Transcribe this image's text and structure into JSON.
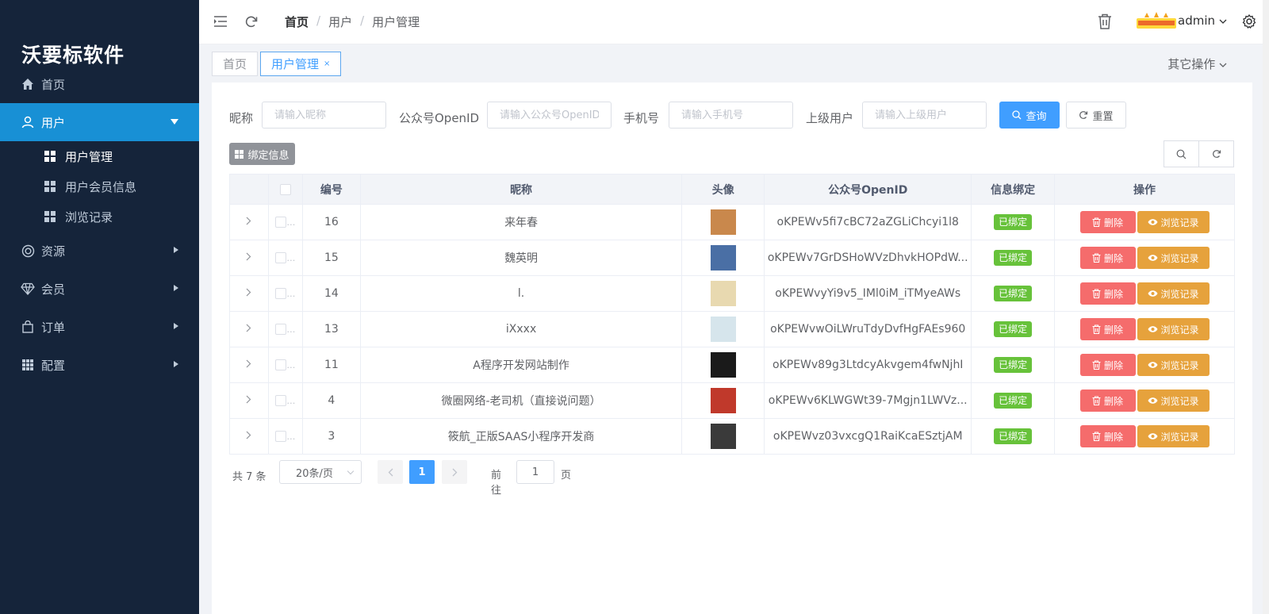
{
  "app": {
    "brand": "沃要标软件",
    "user": "admin"
  },
  "sidebar": {
    "items": [
      {
        "label": "首页",
        "icon": "home-icon"
      },
      {
        "label": "用户",
        "icon": "user-icon",
        "active": true
      },
      {
        "label": "资源",
        "icon": "resource-icon"
      },
      {
        "label": "会员",
        "icon": "diamond-icon"
      },
      {
        "label": "订单",
        "icon": "bag-icon"
      },
      {
        "label": "配置",
        "icon": "grid-icon"
      }
    ],
    "sub_items": [
      {
        "label": "用户管理",
        "active": true
      },
      {
        "label": "用户会员信息"
      },
      {
        "label": "浏览记录"
      }
    ]
  },
  "header": {
    "breadcrumb": [
      "首页",
      "用户",
      "用户管理"
    ],
    "sep": "/"
  },
  "tabs": {
    "items": [
      {
        "label": "首页"
      },
      {
        "label": "用户管理",
        "close": "×"
      }
    ],
    "other_ops": "其它操作"
  },
  "filters": {
    "nickname": {
      "label": "昵称",
      "placeholder": "请输入昵称"
    },
    "openid": {
      "label": "公众号OpenID",
      "placeholder": "请输入公众号OpenID"
    },
    "phone": {
      "label": "手机号",
      "placeholder": "请输入手机号"
    },
    "parent": {
      "label": "上级用户",
      "placeholder": "请输入上级用户"
    },
    "search_btn": "查询",
    "reset_btn": "重置",
    "bind_btn": "绑定信息"
  },
  "table": {
    "headers": [
      "编号",
      "昵称",
      "头像",
      "公众号OpenID",
      "信息绑定",
      "操作"
    ],
    "rows": [
      {
        "id": "16",
        "nickname": "来年春",
        "openid": "oKPEWv5fi7cBC72aZGLiChcyi1l8",
        "bind": "已绑定",
        "avatar_color": "#c9884c"
      },
      {
        "id": "15",
        "nickname": "魏英明",
        "openid": "oKPEWv7GrDSHoWVzDhvkHOPdW...",
        "bind": "已绑定",
        "avatar_color": "#4a6fa5"
      },
      {
        "id": "14",
        "nickname": "l.",
        "openid": "oKPEWvyYi9v5_IMl0iM_iTMyeAWs",
        "bind": "已绑定",
        "avatar_color": "#e8d9b0"
      },
      {
        "id": "13",
        "nickname": "iXxxx",
        "openid": "oKPEWvwOiLWruTdyDvfHgFAEs960",
        "bind": "已绑定",
        "avatar_color": "#d6e5ec"
      },
      {
        "id": "11",
        "nickname": "A程序开发网站制作",
        "openid": "oKPEWv89g3LtdcyAkvgem4fwNjhI",
        "bind": "已绑定",
        "avatar_color": "#1a1a1a"
      },
      {
        "id": "4",
        "nickname": "微圈网络-老司机（直接说问题）",
        "openid": "oKPEWv6KLWGWt39-7Mgjn1LWVz...",
        "bind": "已绑定",
        "avatar_color": "#c0392b"
      },
      {
        "id": "3",
        "nickname": "筱航_正版SAAS小程序开发商",
        "openid": "oKPEWvz03vxcgQ1RaiKcaESztjAM",
        "bind": "已绑定",
        "avatar_color": "#3a3a3a"
      }
    ],
    "ops": {
      "delete": "删除",
      "view": "浏览记录"
    }
  },
  "pager": {
    "total": "共 7 条",
    "size": "20条/页",
    "current": "1",
    "goto": "前往",
    "page_input": "1",
    "page": "页"
  },
  "colors": {
    "sidebar_bg": "#15243a",
    "active": "#1890d5",
    "primary": "#409eff",
    "danger": "#f56c6c",
    "warning": "#e6a23c",
    "success": "#67c23a"
  }
}
